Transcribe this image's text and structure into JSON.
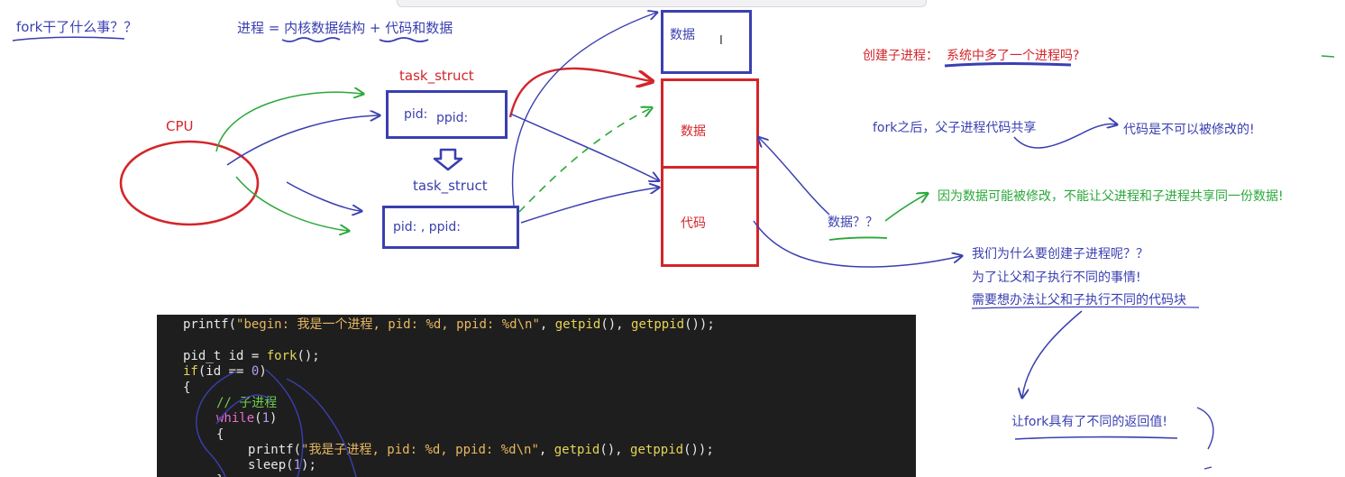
{
  "notes": {
    "fork_question": "fork干了什么事？？",
    "process_def": "进程 = 内核数据结构 + 代码和数据",
    "cpu": "CPU",
    "task_struct_1": "task_struct",
    "task_struct_2": "task_struct",
    "pid1": "pid:",
    "ppid1": "ppid:",
    "pid_ppid2": "pid: , ppid:",
    "data_top": "数据",
    "data_mid": "数据",
    "code_box": "代码",
    "create_child": "创建子进程：",
    "one_more": "系统中多了一个进程吗?",
    "after_fork": "fork之后，父子进程代码共享",
    "code_immutable": "代码是不可以被修改的!",
    "data_q": "数据？？",
    "data_reason": "因为数据可能被修改，不能让父进程和子进程共享同一份数据!",
    "why1": "我们为什么要创建子进程呢？？",
    "why2": "为了让父和子执行不同的事情!",
    "why3": "需要想办法让父和子执行不同的代码块",
    "return_val": "让fork具有了不同的返回值!"
  },
  "code": {
    "line1_a": "printf(",
    "line1_str": "\"begin: 我是一个进程, pid: %d, ppid: %d\\n\"",
    "line1_b": ", ",
    "line1_f1": "getpid",
    "line1_c": "(), ",
    "line1_f2": "getppid",
    "line1_d": "());",
    "line2_a": "pid_t id = ",
    "line2_fn": "fork",
    "line2_b": "();",
    "line3_kw": "if",
    "line3_a": "(id == ",
    "line3_num": "0",
    "line3_b": ")",
    "line4": "{",
    "line5_cmt": "// 子进程",
    "line6_kw": "while",
    "line6_a": "(",
    "line6_num": "1",
    "line6_b": ")",
    "line7": "{",
    "line8_a": "printf(",
    "line8_str": "\"我是子进程, pid: %d, ppid: %d\\n\"",
    "line8_b": ", ",
    "line8_f1": "getpid",
    "line8_c": "(), ",
    "line8_f2": "getppid",
    "line8_d": "());",
    "line9_a": "sleep(",
    "line9_num": "1",
    "line9_b": ");",
    "line10": "}"
  },
  "colors": {
    "ink_blue": "#3a3fb0",
    "ink_red": "#d4252a",
    "ink_green": "#2aa83a",
    "code_bg": "#1e1e1e"
  }
}
